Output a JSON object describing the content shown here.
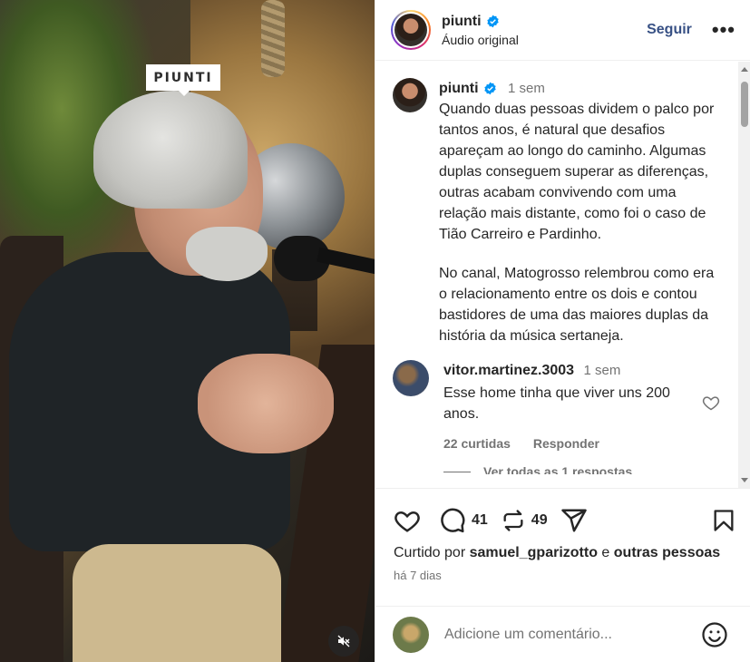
{
  "video": {
    "watermark": "PIUNTI"
  },
  "header": {
    "username": "piunti",
    "subtitle": "Áudio original",
    "follow_label": "Seguir",
    "more_label": "•••"
  },
  "caption": {
    "username": "piunti",
    "time": "1 sem",
    "paragraphs": [
      "Quando duas pessoas dividem o palco por tantos anos, é natural que desafios apareçam ao longo do caminho. Algumas duplas conseguem superar as diferenças, outras acabam convivendo com uma relação mais distante, como foi o caso de Tião Carreiro e Pardinho.",
      "No canal, Matogrosso relembrou como era o relacionamento entre os dois e contou bastidores de uma das maiores duplas da história da música sertaneja."
    ]
  },
  "comment": {
    "username": "vitor.martinez.3003",
    "time": "1 sem",
    "text": "Esse home tinha que viver uns 200 anos.",
    "likes": "22 curtidas",
    "reply_label": "Responder",
    "view_replies": "Ver todas as 1 respostas"
  },
  "actions": {
    "comment_count": "41",
    "repost_count": "49"
  },
  "liked_by": {
    "prefix": "Curtido por",
    "user": "samuel_gparizotto",
    "connector": "e",
    "others": "outras pessoas"
  },
  "posted_ago": "há 7 dias",
  "add_comment": {
    "placeholder": "Adicione um comentário..."
  },
  "colors": {
    "follow": "#385185",
    "verified": "#0095f6",
    "muted_text": "#737373"
  },
  "icons": [
    "verified-icon",
    "heart-icon",
    "comment-icon",
    "repost-icon",
    "share-icon",
    "bookmark-icon",
    "emoji-icon",
    "mute-icon",
    "more-icon"
  ]
}
